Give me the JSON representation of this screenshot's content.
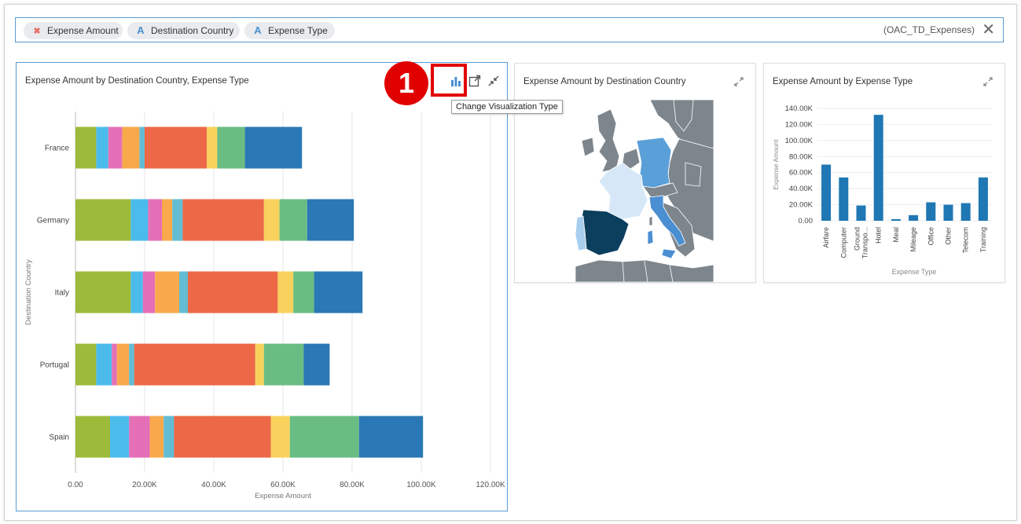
{
  "filter_bar": {
    "pills": [
      {
        "label": "Expense Amount",
        "icon": "measure-icon"
      },
      {
        "label": "Destination Country",
        "icon": "attribute-icon"
      },
      {
        "label": "Expense Type",
        "icon": "attribute-icon"
      }
    ],
    "dataset": "(OAC_TD_Expenses)",
    "close_glyph": "✕"
  },
  "annotation": {
    "badge_number": "1",
    "tooltip": "Change Visualization Type"
  },
  "colors": {
    "accent": "#5a9bd5",
    "highlight": "#e10000",
    "bar_blue": "#1f77b4"
  },
  "chart_data": [
    {
      "type": "bar",
      "orientation": "horizontal",
      "stacked": true,
      "title": "Expense Amount by Destination Country, Expense Type",
      "xlabel": "Expense Amount",
      "ylabel": "Destination Country",
      "xlim": [
        0,
        120000
      ],
      "x_ticks": [
        "0.00",
        "20.00K",
        "40.00K",
        "60.00K",
        "80.00K",
        "100.00K",
        "120.00K"
      ],
      "categories": [
        "France",
        "Germany",
        "Italy",
        "Portugal",
        "Spain"
      ],
      "segment_colors": [
        "#9dbb3b",
        "#4bbbec",
        "#e46fb6",
        "#f9a94b",
        "#62bcd3",
        "#ed6846",
        "#f8d25c",
        "#69bd83",
        "#2a78b5"
      ],
      "series": [
        {
          "values": [
            6000,
            16000,
            16000,
            6000,
            10000
          ]
        },
        {
          "values": [
            3500,
            5000,
            3500,
            4500,
            5500
          ]
        },
        {
          "values": [
            4000,
            4000,
            3500,
            1500,
            6000
          ]
        },
        {
          "values": [
            5000,
            3000,
            7000,
            3500,
            4000
          ]
        },
        {
          "values": [
            1500,
            3000,
            2500,
            1500,
            3000
          ]
        },
        {
          "values": [
            18000,
            23500,
            26000,
            35000,
            28000
          ]
        },
        {
          "values": [
            3000,
            4500,
            4500,
            2500,
            5500
          ]
        },
        {
          "values": [
            8000,
            8000,
            6000,
            11500,
            20000
          ]
        },
        {
          "values": [
            16500,
            13500,
            14000,
            7500,
            18500
          ]
        }
      ]
    },
    {
      "type": "map",
      "title": "Expense Amount by Destination Country",
      "regions": [
        {
          "name": "Spain",
          "color": "#0c3f5e"
        },
        {
          "name": "Portugal",
          "color": "#a9cfef"
        },
        {
          "name": "France",
          "color": "#d6e8f7"
        },
        {
          "name": "Germany",
          "color": "#5a9fd8"
        },
        {
          "name": "Italy",
          "color": "#4a8fd2"
        }
      ]
    },
    {
      "type": "bar",
      "title": "Expense Amount by Expense Type",
      "xlabel": "Expense Type",
      "ylabel": "Expense Amount",
      "ylim": [
        0,
        140000
      ],
      "y_ticks": [
        "0.00",
        "20.00K",
        "40.00K",
        "60.00K",
        "80.00K",
        "100.00K",
        "120.00K",
        "140.00K"
      ],
      "categories": [
        "Airfare",
        "Computer",
        "Ground Transpo...",
        "Hotel",
        "Meal",
        "Mileage",
        "Office",
        "Other",
        "Telecom",
        "Training"
      ],
      "category_lines": [
        [
          "Airfare"
        ],
        [
          "Computer"
        ],
        [
          "Ground",
          "Transpo..."
        ],
        [
          "Hotel"
        ],
        [
          "Meal"
        ],
        [
          "Mileage"
        ],
        [
          "Office"
        ],
        [
          "Other"
        ],
        [
          "Telecom"
        ],
        [
          "Training"
        ]
      ],
      "values": [
        70000,
        54000,
        19000,
        132000,
        2000,
        7000,
        23000,
        20000,
        22000,
        54000
      ],
      "color": "#1f77b4"
    }
  ]
}
